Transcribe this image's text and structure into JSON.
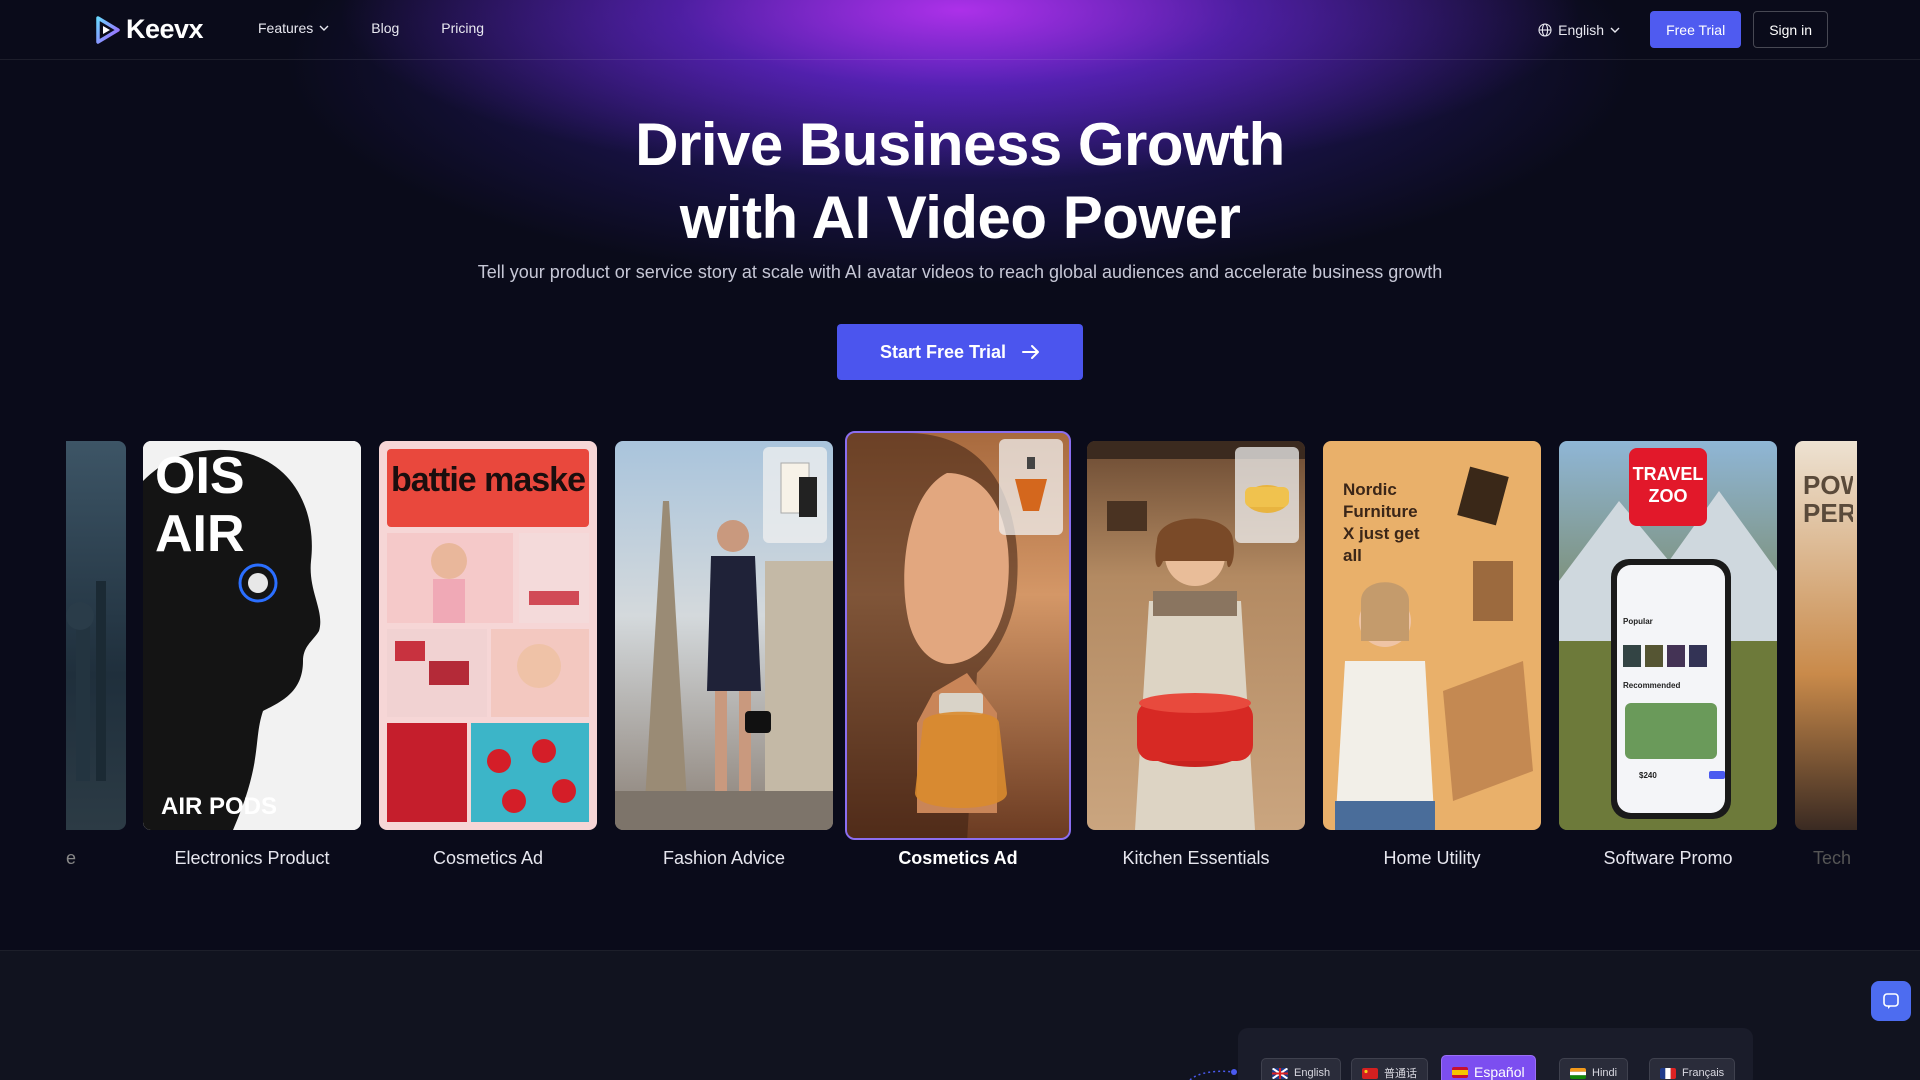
{
  "nav": {
    "logo_text": "Keevx",
    "features_label": "Features",
    "blog_label": "Blog",
    "pricing_label": "Pricing",
    "language": "English",
    "free_trial_label": "Free Trial",
    "sign_in_label": "Sign in"
  },
  "hero": {
    "title_line1": "Drive Business Growth",
    "title_line2": "with AI Video Power",
    "subtitle": "Tell your product or service story at scale with AI avatar videos to reach global audiences and accelerate business growth",
    "cta_label": "Start Free Trial"
  },
  "cards": {
    "partial_left_label": "e",
    "partial_right_label": "Tech",
    "items": [
      {
        "label": "Electronics Product",
        "overlay_top": "OIS AIR",
        "overlay_bottom": "AIR PODS"
      },
      {
        "label": "Cosmetics Ad",
        "overlay_top": "battie maske"
      },
      {
        "label": "Fashion Advice"
      },
      {
        "label": "Cosmetics Ad"
      },
      {
        "label": "Kitchen Essentials"
      },
      {
        "label": "Home Utility",
        "overlay_top": "Nordic Furniture X just get all"
      },
      {
        "label": "Software Promo",
        "overlay_top": "TRAVEL ZOO",
        "overlay_mid_1": "Popular",
        "overlay_mid_2": "Recommended",
        "overlay_price": "$240"
      }
    ],
    "partial_right_overlay": "POW PER"
  },
  "languages": [
    {
      "label": "English"
    },
    {
      "label": "普通话"
    },
    {
      "label": "Español"
    },
    {
      "label": "Hindi"
    },
    {
      "label": "Français"
    }
  ],
  "colors": {
    "accent": "#4f5bf0",
    "active_card_border": "#8b6ef0",
    "active_language": "#7c4ef0"
  }
}
